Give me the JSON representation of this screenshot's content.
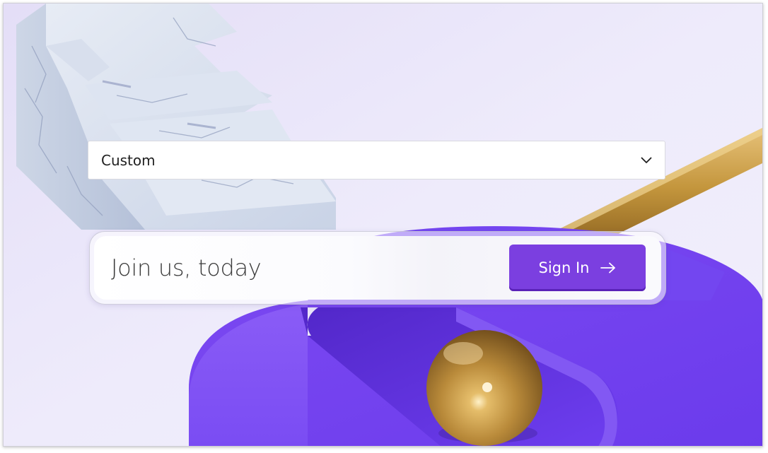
{
  "theme": {
    "accent": "#7b3fe0",
    "accent_dark": "#5a22b8",
    "background": "#ece9fa",
    "shape_purple": "#6a3cf0",
    "gold": "#c4963d"
  },
  "dropdown": {
    "selected": "Custom",
    "icon": "chevron-down-icon"
  },
  "signin": {
    "tagline": "Join us, today",
    "button_label": "Sign In",
    "button_icon": "arrow-right-icon"
  },
  "illustration": {
    "elements": [
      "marble-stairs",
      "purple-platform",
      "gold-sphere",
      "gold-rod"
    ]
  }
}
